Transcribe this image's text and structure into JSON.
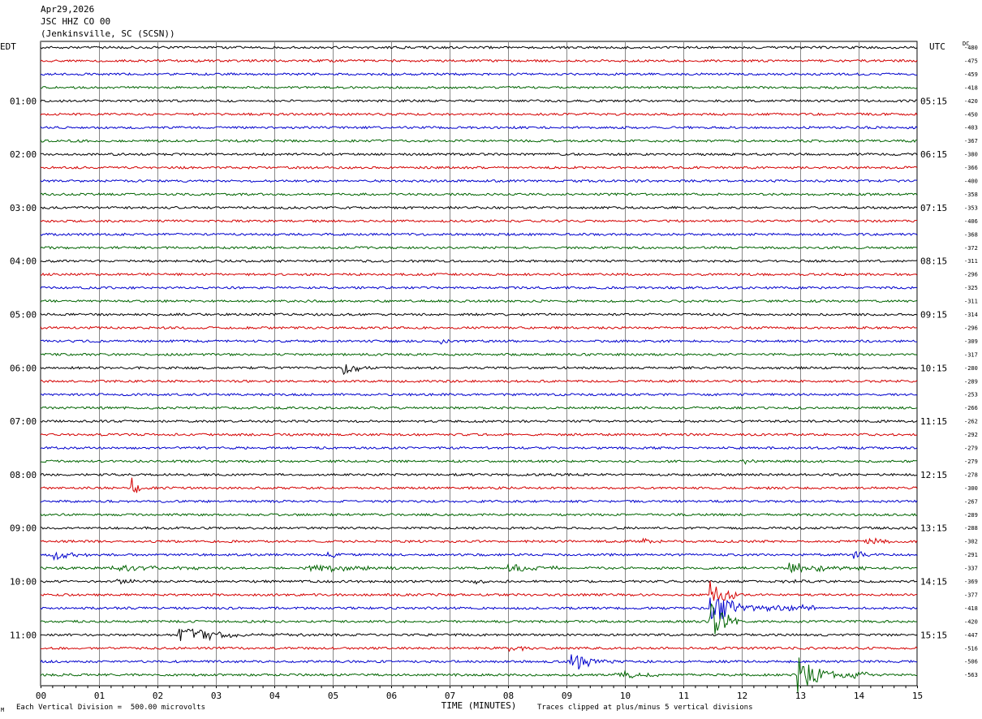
{
  "header": {
    "date": "Apr29,2026",
    "station": "JSC HHZ CO 00",
    "location": "(Jenkinsville, SC (SCSN))"
  },
  "axis_labels": {
    "left_tz": "EDT",
    "right_tz": "UTC",
    "dc": "DC",
    "xlabel": "TIME (MINUTES)"
  },
  "footer": {
    "scale_note": "Each Vertical Division =  500.00 microvolts",
    "clip_note": "Traces clipped at plus/minus 5 vertical divisions",
    "corner_mark": "M"
  },
  "colors": {
    "cycle": [
      "#000000",
      "#d40000",
      "#0000cc",
      "#006400"
    ],
    "grid": "#888888"
  },
  "chart_data": {
    "type": "line",
    "title": "",
    "x_ticks": [
      "00",
      "01",
      "02",
      "03",
      "04",
      "05",
      "06",
      "07",
      "08",
      "09",
      "10",
      "11",
      "12",
      "13",
      "14",
      "15"
    ],
    "xlim": [
      0,
      15
    ],
    "left_hour_labels": [
      "01:00",
      "02:00",
      "03:00",
      "04:00",
      "05:00",
      "06:00",
      "07:00",
      "08:00",
      "09:00",
      "10:00",
      "11:00"
    ],
    "right_hour_labels": [
      "05:15",
      "06:15",
      "07:15",
      "08:15",
      "09:15",
      "10:15",
      "11:15",
      "12:15",
      "13:15",
      "14:15",
      "15:15"
    ],
    "hour_label_trace_index": [
      4,
      8,
      12,
      16,
      20,
      24,
      28,
      32,
      36,
      40,
      44
    ],
    "dc_offsets": [
      -480,
      -475,
      -459,
      -418,
      -420,
      -450,
      -403,
      -367,
      -380,
      -366,
      -400,
      -358,
      -353,
      -406,
      -368,
      -372,
      -311,
      -296,
      -325,
      -311,
      -314,
      -296,
      -309,
      -317,
      -280,
      -289,
      -253,
      -266,
      -262,
      -292,
      -279,
      -279,
      -278,
      -300,
      -267,
      -289,
      -288,
      -302,
      -291,
      -337,
      -369,
      -377,
      -418,
      -420,
      -447,
      -516,
      -506,
      -563
    ],
    "trace_count": 48,
    "noise_level": 1.4,
    "events": [
      {
        "trace": 22,
        "minute": 6.85,
        "duration": 0.15,
        "amp": 3,
        "decay": 0.1
      },
      {
        "trace": 24,
        "minute": 5.15,
        "duration": 0.6,
        "amp": 9,
        "decay": 0.3
      },
      {
        "trace": 31,
        "minute": 12.0,
        "duration": 0.2,
        "amp": 3,
        "decay": 0.15
      },
      {
        "trace": 33,
        "minute": 1.55,
        "duration": 0.35,
        "amp": 18,
        "decay": 0.1
      },
      {
        "trace": 33,
        "minute": 8.0,
        "duration": 0.3,
        "amp": 3,
        "decay": 0.2
      },
      {
        "trace": 37,
        "minute": 10.3,
        "duration": 0.4,
        "amp": 4,
        "decay": 0.3
      },
      {
        "trace": 37,
        "minute": 14.1,
        "duration": 0.5,
        "amp": 6,
        "decay": 0.3
      },
      {
        "trace": 38,
        "minute": 0.15,
        "duration": 0.7,
        "amp": 7,
        "decay": 0.4
      },
      {
        "trace": 38,
        "minute": 4.85,
        "duration": 0.35,
        "amp": 6,
        "decay": 0.2
      },
      {
        "trace": 38,
        "minute": 13.9,
        "duration": 0.4,
        "amp": 7,
        "decay": 0.2
      },
      {
        "trace": 39,
        "minute": 1.2,
        "duration": 1.5,
        "amp": 4,
        "decay": 0.8
      },
      {
        "trace": 39,
        "minute": 4.6,
        "duration": 1.5,
        "amp": 5,
        "decay": 0.8
      },
      {
        "trace": 39,
        "minute": 8.0,
        "duration": 1.4,
        "amp": 6,
        "decay": 0.6
      },
      {
        "trace": 39,
        "minute": 12.8,
        "duration": 1.9,
        "amp": 7,
        "decay": 0.8
      },
      {
        "trace": 40,
        "minute": 1.3,
        "duration": 0.4,
        "amp": 4,
        "decay": 0.3
      },
      {
        "trace": 40,
        "minute": 7.4,
        "duration": 0.6,
        "amp": 3,
        "decay": 0.4
      },
      {
        "trace": 40,
        "minute": 12.7,
        "duration": 0.4,
        "amp": 3,
        "decay": 0.3
      },
      {
        "trace": 41,
        "minute": 11.45,
        "duration": 0.5,
        "amp": 20,
        "decay": 0.3
      },
      {
        "trace": 42,
        "minute": 11.45,
        "duration": 1.8,
        "amp": 26,
        "decay": 0.35
      },
      {
        "trace": 43,
        "minute": 11.45,
        "duration": 0.5,
        "amp": 26,
        "decay": 0.3
      },
      {
        "trace": 44,
        "minute": 2.35,
        "duration": 2.3,
        "amp": 11,
        "decay": 0.6
      },
      {
        "trace": 45,
        "minute": 8.0,
        "duration": 0.6,
        "amp": 3,
        "decay": 0.4
      },
      {
        "trace": 46,
        "minute": 9.05,
        "duration": 1.0,
        "amp": 16,
        "decay": 0.3
      },
      {
        "trace": 47,
        "minute": 9.8,
        "duration": 1.5,
        "amp": 5,
        "decay": 0.6
      },
      {
        "trace": 47,
        "minute": 12.95,
        "duration": 1.2,
        "amp": 28,
        "decay": 0.3
      }
    ]
  }
}
